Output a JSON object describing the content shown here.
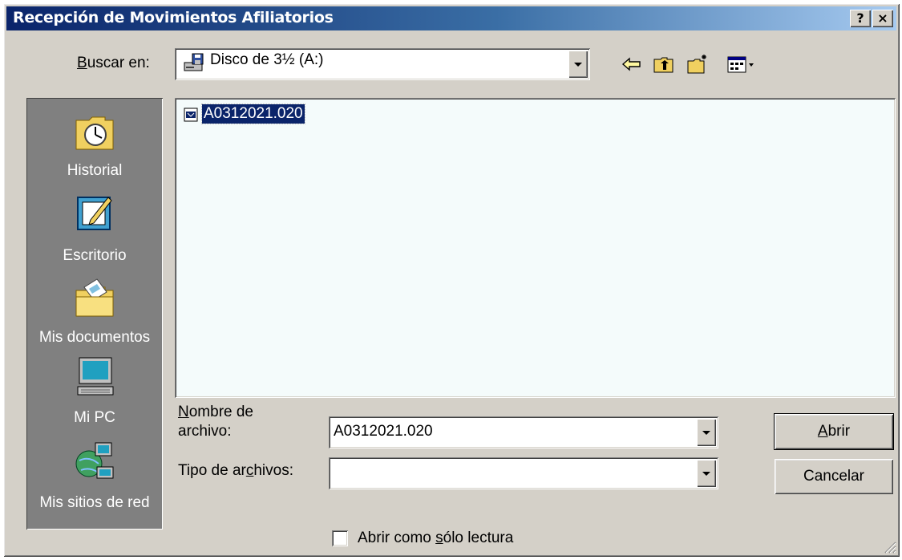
{
  "window": {
    "title": "Recepción de Movimientos Afiliatorios",
    "help_button": "?",
    "close_button": "×"
  },
  "toolbar": {
    "look_in_label_underlined": "B",
    "look_in_label_rest": "uscar en:",
    "look_in_value": "Disco de 3½ (A:)",
    "look_in_icon": "floppy-drive-icon",
    "buttons": [
      {
        "name": "back",
        "icon": "back-arrow-icon"
      },
      {
        "name": "up-one-level",
        "icon": "folder-up-icon"
      },
      {
        "name": "new-folder",
        "icon": "new-folder-icon"
      },
      {
        "name": "view-menu",
        "icon": "view-menu-icon"
      }
    ]
  },
  "places_bar": {
    "items": [
      {
        "label": "Historial",
        "icon": "history-icon"
      },
      {
        "label": "Escritorio",
        "icon": "desktop-icon"
      },
      {
        "label": "Mis documentos",
        "icon": "my-documents-icon"
      },
      {
        "label": "Mi PC",
        "icon": "my-computer-icon"
      },
      {
        "label": "Mis sitios de red",
        "icon": "network-places-icon"
      }
    ]
  },
  "file_list": {
    "items": [
      {
        "name": "A0312021.020",
        "selected": true,
        "icon": "file-icon"
      }
    ]
  },
  "form": {
    "filename_label_line1_underlined": "N",
    "filename_label_line1_rest": "ombre de",
    "filename_label_line2": "archivo:",
    "filename_value": "A0312021.020",
    "filetype_label_pre": "Tipo de ar",
    "filetype_label_underlined": "c",
    "filetype_label_post": "hivos:",
    "filetype_value": "",
    "readonly_label_pre": "Abrir como ",
    "readonly_label_underlined": "s",
    "readonly_label_post": "ólo lectura",
    "readonly_checked": false
  },
  "buttons": {
    "open_underlined": "A",
    "open_rest": "brir",
    "cancel": "Cancelar"
  },
  "colors": {
    "title_gradient_start": "#0a246a",
    "title_gradient_end": "#a6caf0",
    "face": "#d4d0c8",
    "places_bg": "#808080",
    "selection": "#0a246a"
  }
}
